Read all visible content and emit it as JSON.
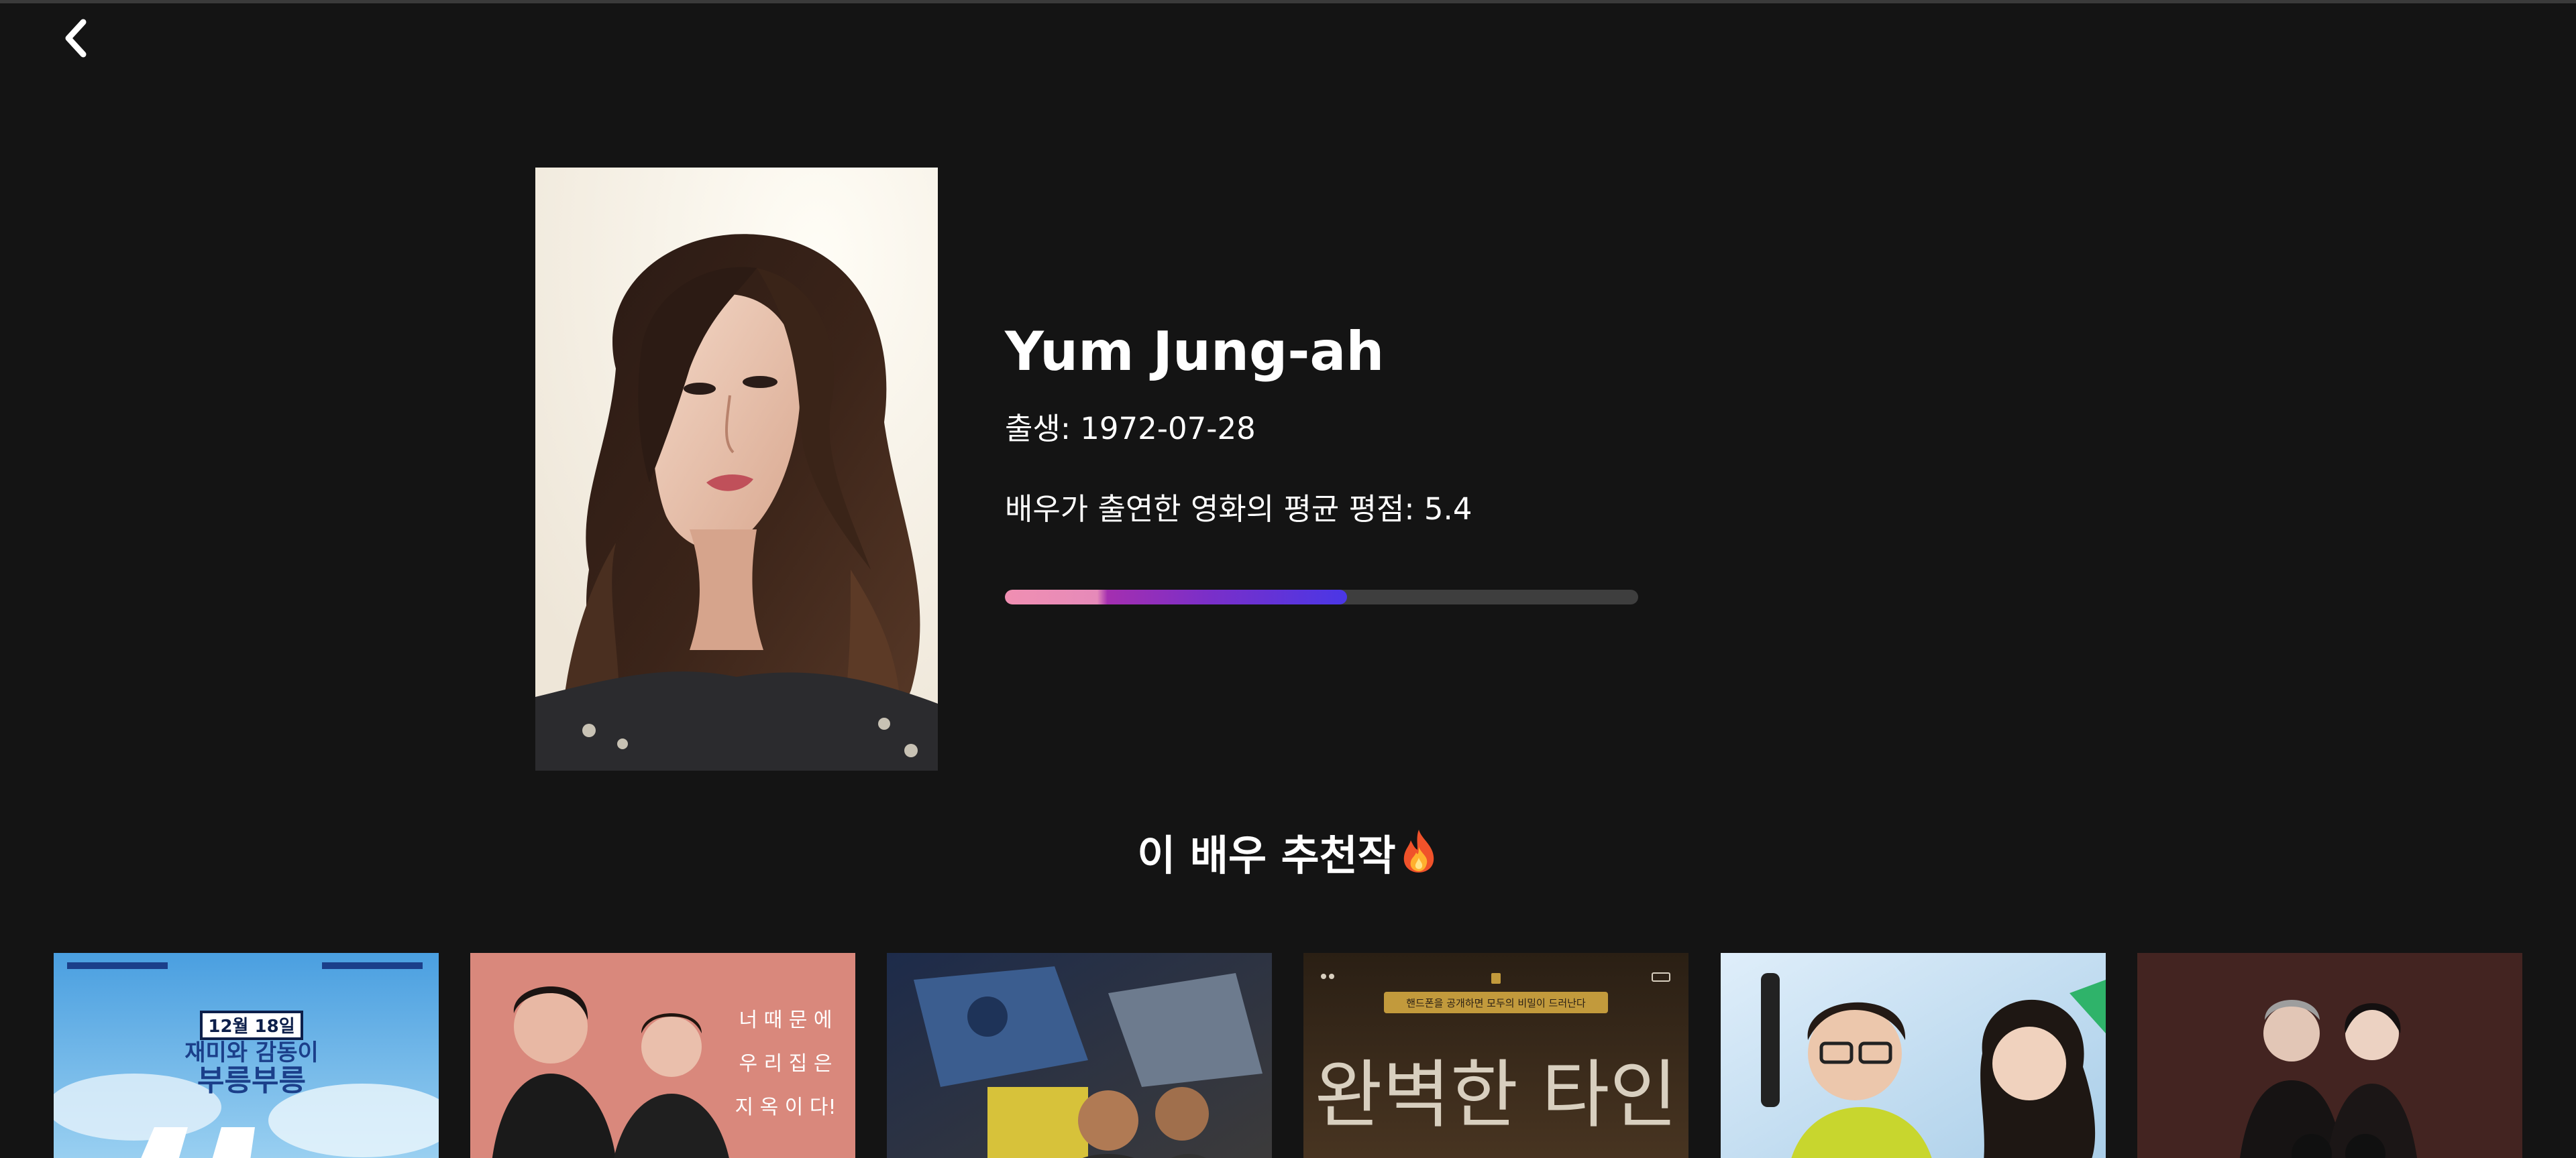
{
  "actor": {
    "name": "Yum Jung-ah",
    "birth_label": "출생",
    "birth_date": "1972-07-28",
    "rating_label": "배우가 출연한 영화의 평균 평점",
    "rating_value": "5.4",
    "rating_fraction": 0.54
  },
  "recommend": {
    "title": "이 배우 추천작"
  },
  "icons": {
    "back": "chevron-left-icon",
    "fire": "fire-icon"
  },
  "colors": {
    "background": "#141414",
    "rating_track": "#3e3e3e",
    "rating_gradient": [
      "#f08fb2",
      "#a42fb0",
      "#4a37e6"
    ]
  },
  "posters": [
    {
      "title_texts": [
        "12월 18일",
        "재미와 감동이",
        "부릉부릉"
      ],
      "theme": "sky-blue"
    },
    {
      "title_texts": [
        "너 때 문 에",
        "우 리 집 은",
        "지 옥 이 다!"
      ],
      "theme": "salmon"
    },
    {
      "title_texts": [],
      "theme": "mech"
    },
    {
      "title_texts": [
        "핸드폰을 공개하면 모두의 비밀이 드러난다",
        "완벽한 타인"
      ],
      "theme": "dark-brown"
    },
    {
      "title_texts": [],
      "theme": "light-blue"
    },
    {
      "title_texts": [],
      "theme": "maroon"
    }
  ]
}
